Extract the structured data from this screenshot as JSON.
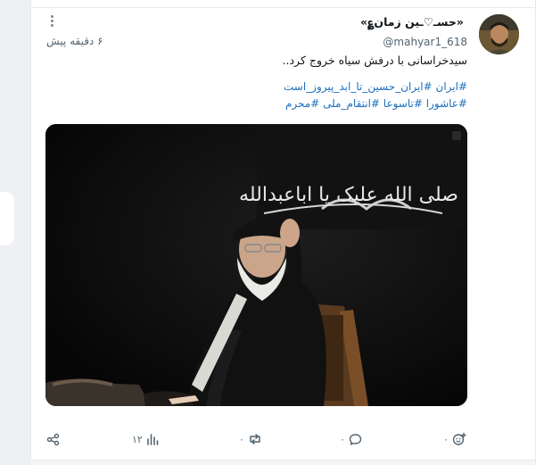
{
  "post": {
    "display_name": "«حسـ♡ـین زمان؏»",
    "handle": "@mahyar1_618",
    "time": "۶ دقیقه پیش",
    "text": "سیدخراسانی با درفش سیاه خروج کرد..",
    "hashtags_line1": "#ایران #ایران_حسین_تا_ابد_پیروز_است",
    "hashtags_line2": "#عاشورا #تاسوعا #انتقام_ملی #محرم",
    "banner_text": "صلی الله علیک یا اباعبدالله"
  },
  "actions": {
    "views": "۱۲",
    "reposts": "۰",
    "replies": "۰",
    "reactions": "۰"
  },
  "icons": [
    "more-vertical-icon",
    "share-icon",
    "views-bar-icon",
    "repost-icon",
    "reply-bubble-icon",
    "add-reaction-icon"
  ],
  "colors": {
    "link": "#1d6fbf",
    "muted": "#536471",
    "text": "#0f1419"
  }
}
